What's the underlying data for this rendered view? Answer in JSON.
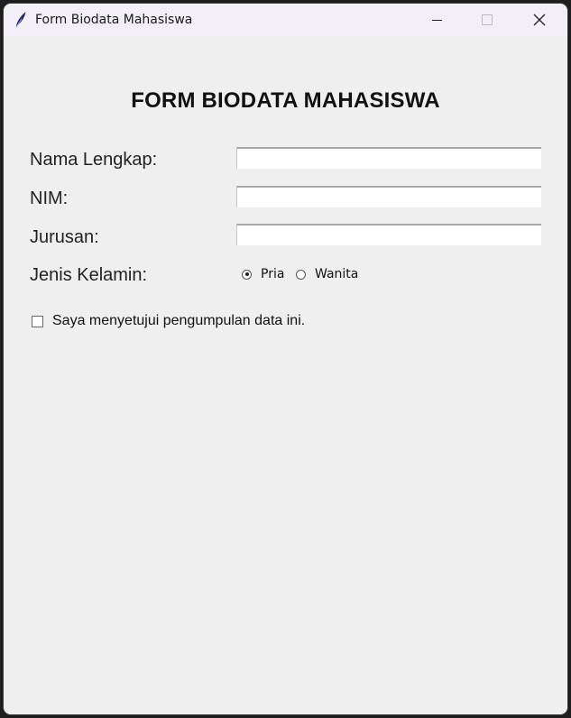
{
  "window": {
    "title": "Form Biodata Mahasiswa",
    "icon": "feather-icon"
  },
  "form": {
    "heading": "FORM BIODATA MAHASISWA",
    "fields": [
      {
        "label": "Nama Lengkap:",
        "value": ""
      },
      {
        "label": "NIM:",
        "value": ""
      },
      {
        "label": "Jurusan:",
        "value": ""
      }
    ],
    "gender": {
      "label": "Jenis Kelamin:",
      "options": [
        "Pria",
        "Wanita"
      ],
      "selected": "Pria"
    },
    "consent": {
      "label": "Saya menyetujui pengumpulan data ini.",
      "checked": false
    }
  }
}
